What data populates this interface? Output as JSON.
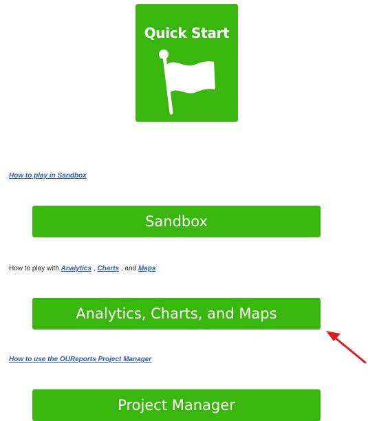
{
  "quick_start": {
    "title": "Quick Start",
    "icon": "flag-icon",
    "color": "#3ab70f"
  },
  "sandbox_section": {
    "help_link": "How to play in Sandbox",
    "button_label": "Sandbox"
  },
  "analytics_section": {
    "help_prefix": "How to play with ",
    "analytics_link": "Analytics",
    "sep1": " , ",
    "charts_link": "Charts",
    "sep2": " , and ",
    "maps_link": "Maps",
    "button_label": "Analytics, Charts, and Maps"
  },
  "project_section": {
    "help_link": "How to use the OUReports Project Manager",
    "button_label": "Project Manager"
  },
  "annotation": {
    "arrow_color": "#e01b1b",
    "icon": "red-arrow-icon"
  },
  "colors": {
    "button_green": "#3ab70f",
    "link_blue": "#2b5fb8"
  }
}
